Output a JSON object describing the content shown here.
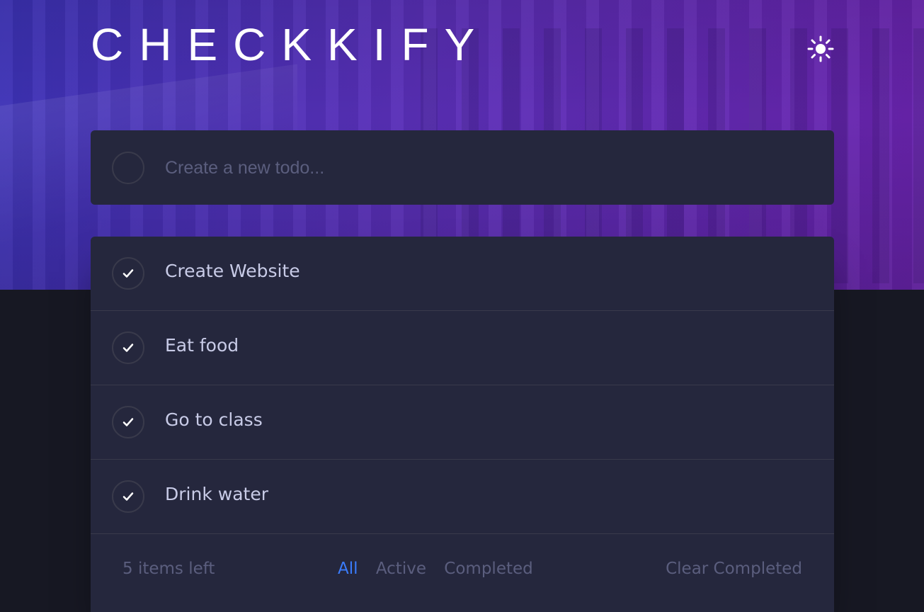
{
  "app": {
    "title": "CHECKKIFY",
    "theme_icon": "sun-icon"
  },
  "new_todo": {
    "placeholder": "Create a new todo..."
  },
  "todos": [
    {
      "label": "Create Website",
      "icon": "check-icon"
    },
    {
      "label": "Eat food",
      "icon": "check-icon"
    },
    {
      "label": "Go to class",
      "icon": "check-icon"
    },
    {
      "label": "Drink water",
      "icon": "check-icon"
    }
  ],
  "footer": {
    "items_left": "5 items left",
    "filters": [
      "All",
      "Active",
      "Completed"
    ],
    "active_filter": "All",
    "clear_label": "Clear Completed"
  },
  "colors": {
    "background": "#171823",
    "card": "#25273d",
    "text": "#c8cbe7",
    "muted": "#5b5e7e",
    "accent": "#3a7cfd",
    "border": "#393a4b"
  }
}
